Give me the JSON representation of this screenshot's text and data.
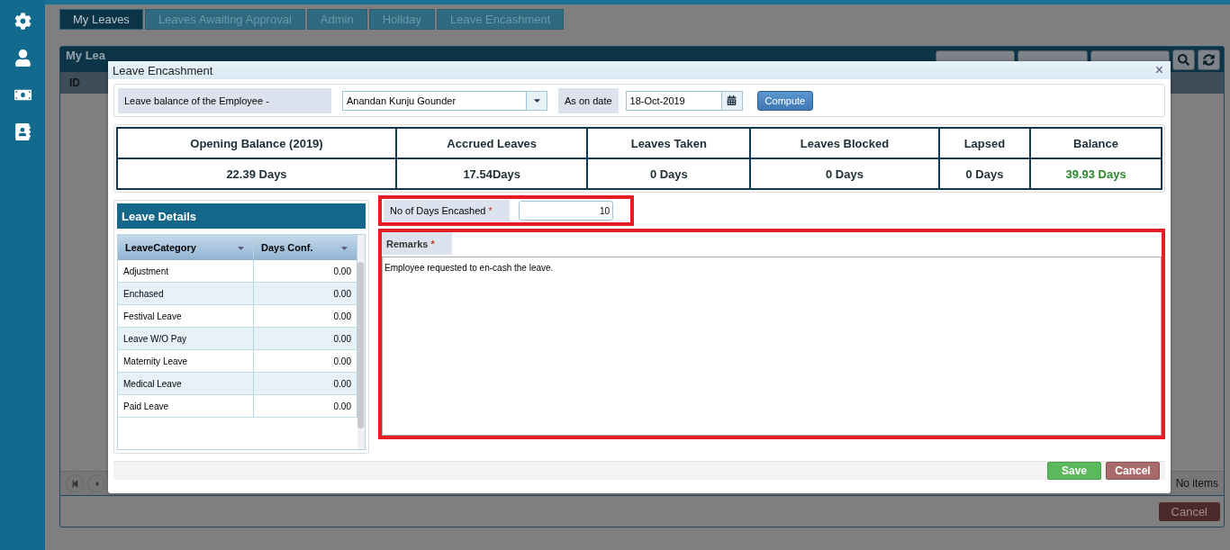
{
  "tabs": [
    {
      "label": "My Leaves",
      "selected": true
    },
    {
      "label": "Leaves Awaiting Approval",
      "selected": false
    },
    {
      "label": "Admin",
      "selected": false
    },
    {
      "label": "Holiday",
      "selected": false
    },
    {
      "label": "Leave Encashment",
      "selected": false
    }
  ],
  "panel": {
    "title": "My Lea",
    "grid_column": "ID",
    "pager_status": "No items",
    "cancel": "Cancel"
  },
  "dialog": {
    "title": "Leave Encashment",
    "close": "×",
    "employee": {
      "label": "Leave balance of the Employee -",
      "value": "Anandan Kunju Gounder"
    },
    "date": {
      "label": "As on date",
      "value": "18-Oct-2019"
    },
    "compute": "Compute",
    "summary": [
      {
        "heading": "Opening Balance (2019)",
        "value": "22.39 Days",
        "highlight": false
      },
      {
        "heading": "Accrued Leaves",
        "value": "17.54Days",
        "highlight": false
      },
      {
        "heading": "Leaves Taken",
        "value": "0 Days",
        "highlight": false
      },
      {
        "heading": "Leaves Blocked",
        "value": "0 Days",
        "highlight": false
      },
      {
        "heading": "Lapsed",
        "value": "0 Days",
        "highlight": false
      },
      {
        "heading": "Balance",
        "value": "39.93 Days",
        "highlight": true
      }
    ],
    "leave_details": {
      "title": "Leave Details",
      "columns": [
        "LeaveCategory",
        "Days Conf."
      ],
      "rows": [
        [
          "Adjustment",
          "0.00"
        ],
        [
          "Enchased",
          "0.00"
        ],
        [
          "Festival Leave",
          "0.00"
        ],
        [
          "Leave W/O Pay",
          "0.00"
        ],
        [
          "Maternity Leave",
          "0.00"
        ],
        [
          "Medical Leave",
          "0.00"
        ],
        [
          "Paid Leave",
          "0.00"
        ]
      ]
    },
    "days_encashed": {
      "label": "No of Days Encashed",
      "required": "*",
      "value": "10"
    },
    "remarks": {
      "label": "Remarks",
      "required": "*",
      "value": "Employee requested to en-cash the leave."
    },
    "buttons": [
      {
        "label": "Save",
        "kind": "primary"
      },
      {
        "label": "Cancel",
        "kind": "danger"
      }
    ]
  }
}
